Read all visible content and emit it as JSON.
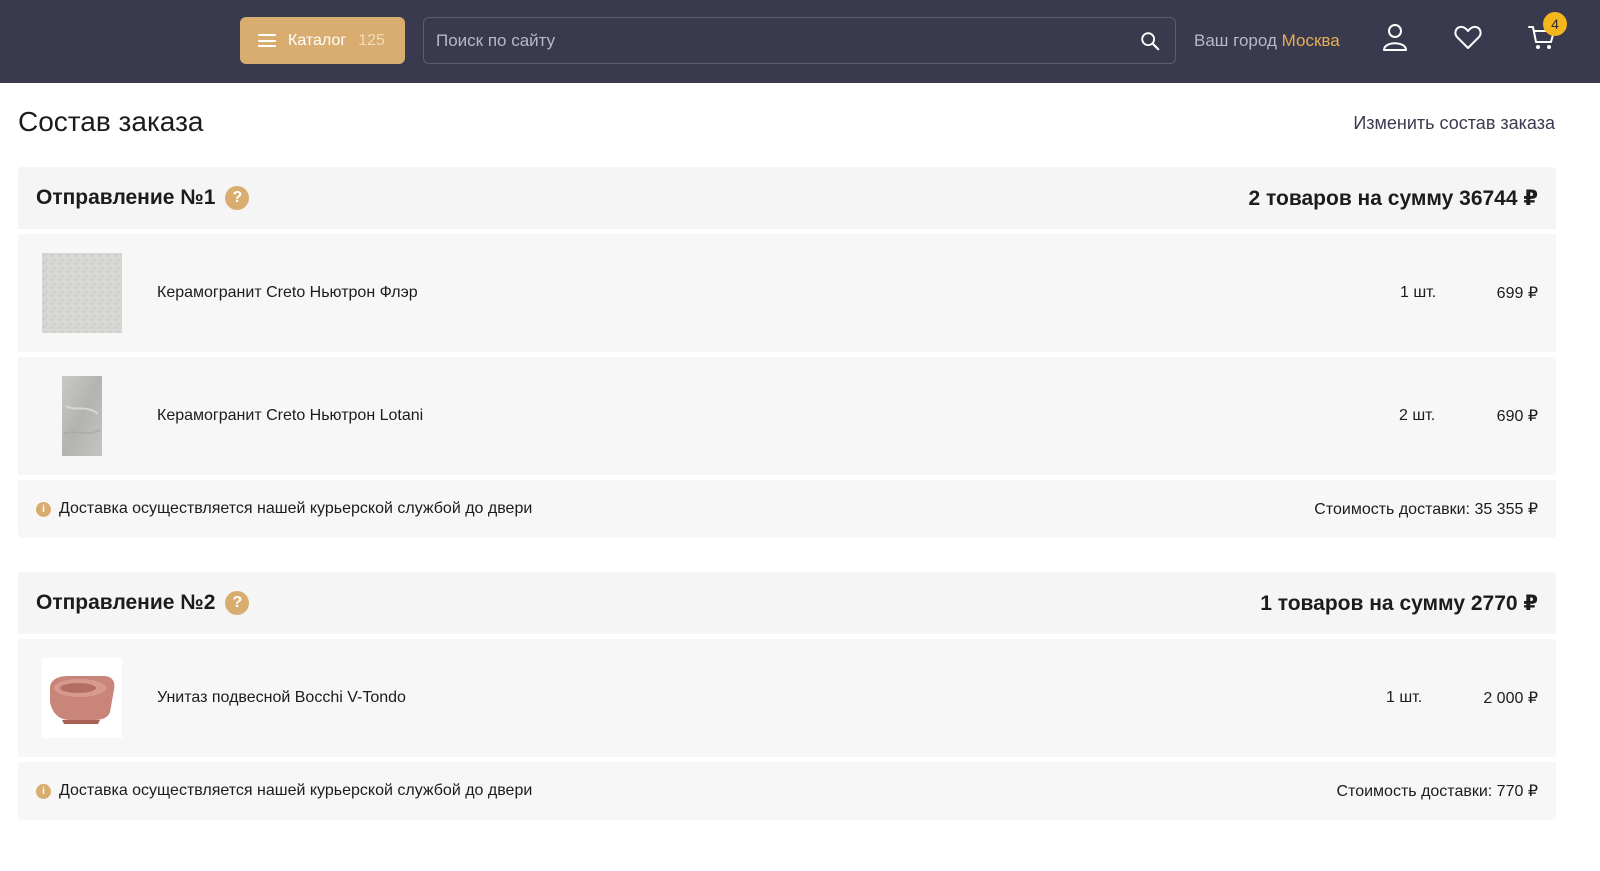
{
  "header": {
    "catalog_label": "Каталог",
    "catalog_count": "125",
    "search_placeholder": "Поиск по сайту",
    "city_prefix": "Ваш город",
    "city_name": "Москва",
    "cart_count": "4",
    "icons": [
      "menu-icon",
      "search-icon",
      "user-icon",
      "heart-icon",
      "cart-icon"
    ]
  },
  "page": {
    "title": "Состав заказа",
    "edit_link": "Изменить состав заказа"
  },
  "shipments": [
    {
      "title": "Отправление №1",
      "help": "?",
      "total": "2 товаров на сумму 36744 ₽",
      "items": [
        {
          "name": "Керамогранит Creto Ньютрон Флэр",
          "qty": "1 шт.",
          "price": "699 ₽"
        },
        {
          "name": "Керамогранит Creto Ньютрон Lotani",
          "qty": "2 шт.",
          "price": "690 ₽"
        }
      ],
      "delivery_text": "Доставка осуществляется нашей курьерской службой до двери",
      "delivery_cost": "Стоимость доставки: 35 355 ₽"
    },
    {
      "title": "Отправление №2",
      "help": "?",
      "total": "1 товаров на сумму 2770 ₽",
      "items": [
        {
          "name": "Унитаз подвесной Bocchi V-Tondo",
          "qty": "1 шт.",
          "price": "2 000 ₽"
        }
      ],
      "delivery_text": "Доставка осуществляется нашей курьерской службой до двери",
      "delivery_cost": "Стоимость доставки: 770 ₽"
    }
  ],
  "colors": {
    "header_bg": "#3a3a4e",
    "accent": "#d8ad6f",
    "city_accent": "#e7ad54",
    "badge": "#f5b51d"
  }
}
